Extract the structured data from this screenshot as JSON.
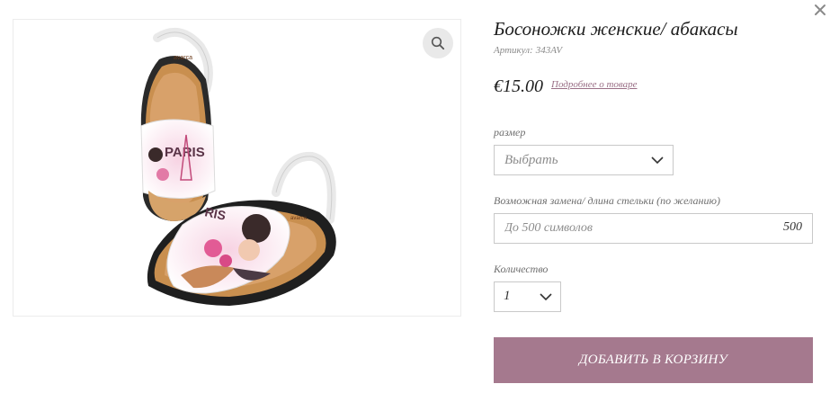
{
  "product": {
    "title": "Босоножки женские/ абакасы",
    "sku_label": "Артикул:",
    "sku_value": "343AV",
    "price": "€15.00",
    "details_link": "Подробнее о товаре"
  },
  "options": {
    "size_label": "размер",
    "size_selected": "Выбрать",
    "insole_label": "Возможная замена/ длина стельки (по желанию)",
    "insole_placeholder": "До 500 символов",
    "insole_counter": "500",
    "quantity_label": "Количество",
    "quantity_value": "1"
  },
  "actions": {
    "add_to_cart": "ДОБАВИТЬ В КОРЗИНУ"
  },
  "image": {
    "brand_text": "avarca",
    "print_text_1": "PARIS",
    "print_text_2": "RIS"
  },
  "icons": {
    "close": "close-icon",
    "zoom": "search-icon",
    "dropdown": "chevron-down-icon"
  },
  "colors": {
    "accent": "#a5798e",
    "link": "#9a6f86",
    "border": "#c9c9c9"
  }
}
